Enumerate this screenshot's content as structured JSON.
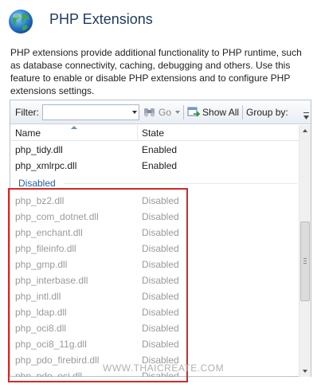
{
  "page": {
    "title": "PHP Extensions",
    "description": "PHP extensions provide additional functionality to PHP runtime, such as database connectivity, caching, debugging and others. Use this feature to enable or disable PHP extensions and to configure PHP extensions settings."
  },
  "toolbar": {
    "filter_label": "Filter:",
    "filter_value": "",
    "go_label": "Go",
    "show_all_label": "Show All",
    "group_by_label": "Group by:"
  },
  "columns": {
    "name": "Name",
    "state": "State"
  },
  "enabled_rows": [
    {
      "name": "php_tidy.dll",
      "state": "Enabled"
    },
    {
      "name": "php_xmlrpc.dll",
      "state": "Enabled"
    }
  ],
  "disabled_group_label": "Disabled",
  "disabled_rows": [
    {
      "name": "php_bz2.dll",
      "state": "Disabled"
    },
    {
      "name": "php_com_dotnet.dll",
      "state": "Disabled"
    },
    {
      "name": "php_enchant.dll",
      "state": "Disabled"
    },
    {
      "name": "php_fileinfo.dll",
      "state": "Disabled"
    },
    {
      "name": "php_gmp.dll",
      "state": "Disabled"
    },
    {
      "name": "php_interbase.dll",
      "state": "Disabled"
    },
    {
      "name": "php_intl.dll",
      "state": "Disabled"
    },
    {
      "name": "php_ldap.dll",
      "state": "Disabled"
    },
    {
      "name": "php_oci8.dll",
      "state": "Disabled"
    },
    {
      "name": "php_oci8_11g.dll",
      "state": "Disabled"
    },
    {
      "name": "php_pdo_firebird.dll",
      "state": "Disabled"
    },
    {
      "name": "php_pdo_oci.dll",
      "state": "Disabled"
    }
  ],
  "watermark": "WWW.THAICREATE.COM",
  "colors": {
    "highlight": "#d12a2a",
    "group_header": "#2a5d9f",
    "disabled_text": "#9a9a9a",
    "title": "#1e3a5f"
  },
  "icons": {
    "header": "globe-icon",
    "go": "go-icon",
    "show_all": "show-all-icon"
  }
}
